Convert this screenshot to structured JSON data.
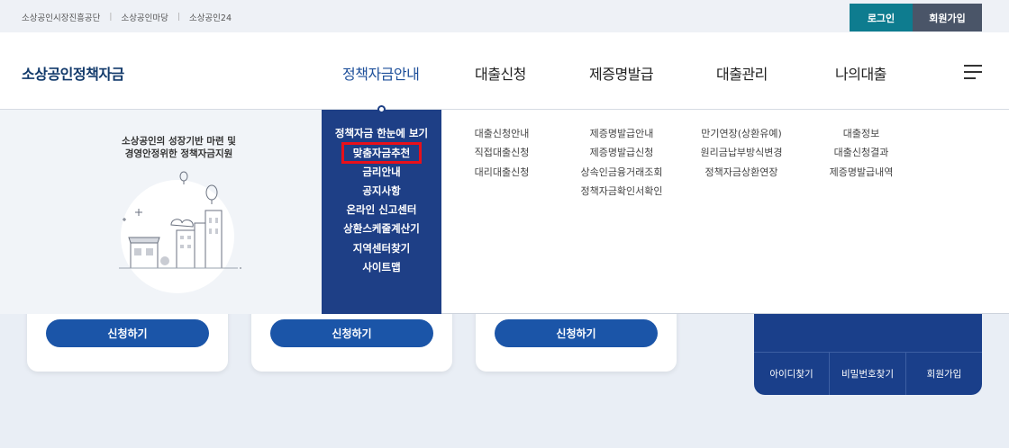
{
  "utility_links": [
    "소상공인시장진흥공단",
    "소상공인마당",
    "소상공인24"
  ],
  "auth": {
    "login": "로그인",
    "join": "회원가입"
  },
  "logo": "소상공인정책자금",
  "gnb": [
    "정책자금안내",
    "대출신청",
    "제증명발급",
    "대출관리",
    "나의대출"
  ],
  "promo": {
    "line1": "소상공인의 성장기반 마련 및",
    "line2": "경영안정위한 정책자금지원"
  },
  "policy_menu": [
    "정책자금 한눈에 보기",
    "맞춤자금추천",
    "금리안내",
    "공지사항",
    "온라인 신고센터",
    "상환스케줄계산기",
    "지역센터찾기",
    "사이트맵"
  ],
  "loan_apply_menu": [
    "대출신청안내",
    "직접대출신청",
    "대리대출신청"
  ],
  "certificate_menu": [
    "제증명발급안내",
    "제증명발급신청",
    "상속인금융거래조회",
    "정책자금확인서확인"
  ],
  "loan_manage_menu": [
    "만기연장(상환유예)",
    "원리금납부방식변경",
    "정책자금상환연장"
  ],
  "my_loan_menu": [
    "대출정보",
    "대출신청결과",
    "제증명발급내역"
  ],
  "cards": [
    {
      "button": "신청하기"
    },
    {
      "button": "신청하기"
    },
    {
      "button": "신청하기"
    }
  ],
  "login_panel": {
    "find_id": "아이디찾기",
    "find_pw": "비밀번호찾기",
    "join": "회원가입"
  },
  "colors": {
    "brand_navy": "#1e3f86",
    "accent_teal": "#0e7c8f",
    "highlight_red": "#e8101a"
  }
}
